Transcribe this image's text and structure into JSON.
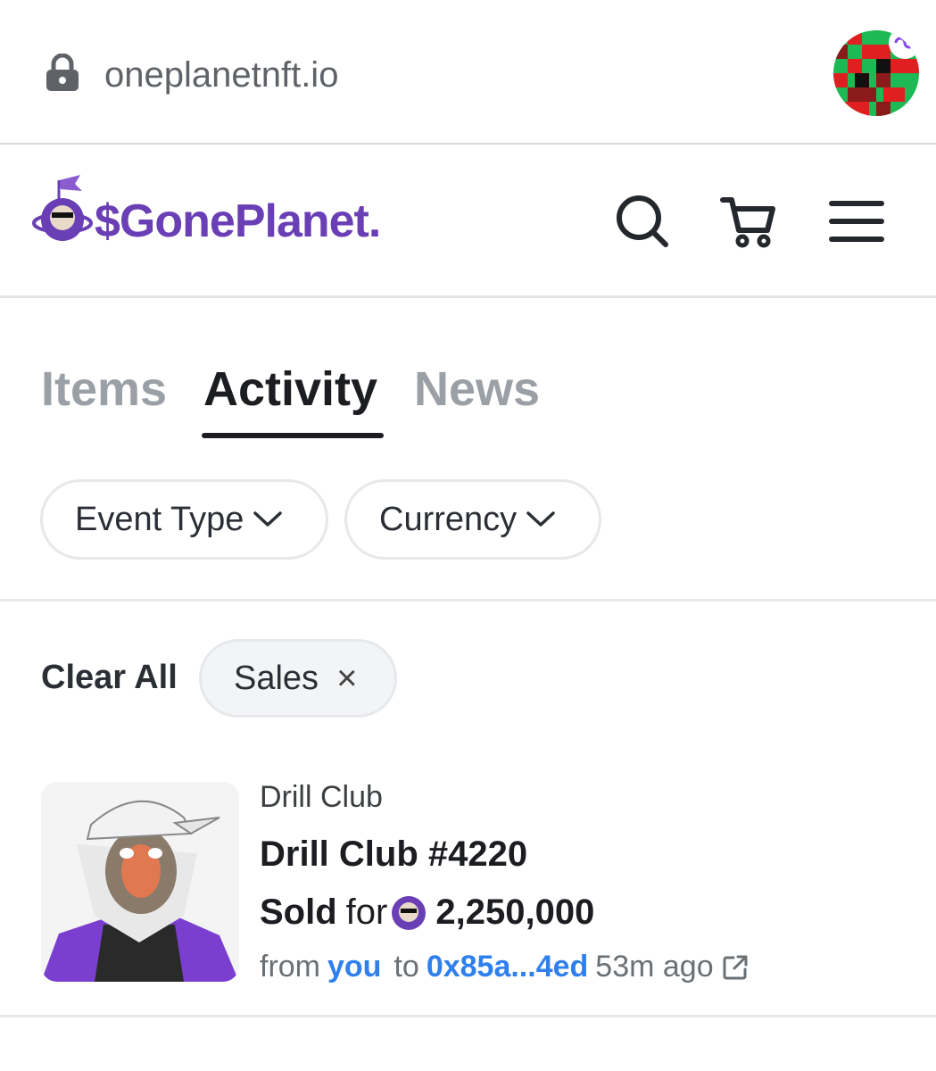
{
  "browser": {
    "url": "oneplanetnft.io"
  },
  "header": {
    "logo_text": "$GonePlanet."
  },
  "tabs": [
    {
      "label": "Items"
    },
    {
      "label": "Activity",
      "active": true
    },
    {
      "label": "News"
    }
  ],
  "filters": {
    "event_type": "Event Type",
    "currency": "Currency"
  },
  "active_filters": {
    "clear_all": "Clear All",
    "chips": [
      {
        "label": "Sales",
        "remove": "×"
      }
    ]
  },
  "activity": [
    {
      "collection": "Drill Club",
      "title": "Drill Club #4220",
      "action": "Sold",
      "for_word": "for",
      "price": "2,250,000",
      "from_word": "from",
      "from": "you",
      "to_word": "to",
      "to": "0x85a...4ed",
      "time": "53m ago"
    }
  ],
  "colors": {
    "brand_purple": "#6a3fb5",
    "link_blue": "#2f80ed",
    "inactive_tab": "#9aa0a6"
  }
}
